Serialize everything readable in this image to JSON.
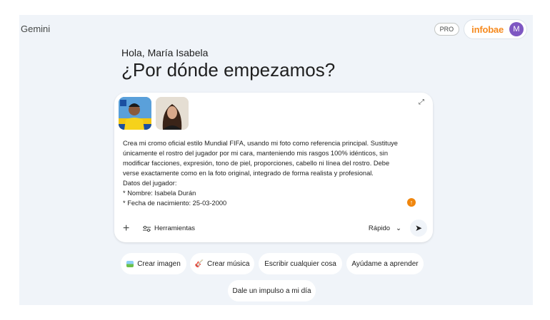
{
  "app": {
    "brand": "Gemini",
    "plan_badge": "PRO",
    "account_brand": "infobae",
    "avatar_letter": "M",
    "accent": "#f68a1f",
    "avatar_color": "#7e57c2"
  },
  "greeting": "Hola, María Isabela",
  "headline": "¿Por dónde empezamos?",
  "composer": {
    "attachments": [
      {
        "icon": "soccer-player-photo"
      },
      {
        "icon": "woman-portrait-photo"
      }
    ],
    "prompt_lines": [
      "Crea mi cromo oficial estilo Mundial FIFA, usando mi foto como referencia principal. Sustituye",
      "únicamente el rostro del jugador por mi cara, manteniendo mis rasgos 100% idénticos, sin",
      "modificar facciones, expresión, tono de piel, proporciones, cabello ni línea del rostro. Debe",
      "verse exactamente como en la foto original, integrado de forma realista y profesional.",
      "Datos del jugador:",
      "* Nombre: Isabela Durán",
      "* Fecha de nacimiento: 25-03-2000"
    ],
    "tools_label": "Herramientas",
    "model_label": "Rápido",
    "model_chevron": "⌄",
    "plus": "+",
    "send": "➤",
    "expand": "⤢",
    "upload": "↑"
  },
  "chips": [
    {
      "label": "Crear imagen",
      "icon": "image-icon"
    },
    {
      "label": "Crear música",
      "icon": "guitar-icon"
    },
    {
      "label": "Escribir cualquier cosa"
    },
    {
      "label": "Ayúdame a aprender"
    },
    {
      "label": "Dale un impulso a mi día"
    }
  ]
}
